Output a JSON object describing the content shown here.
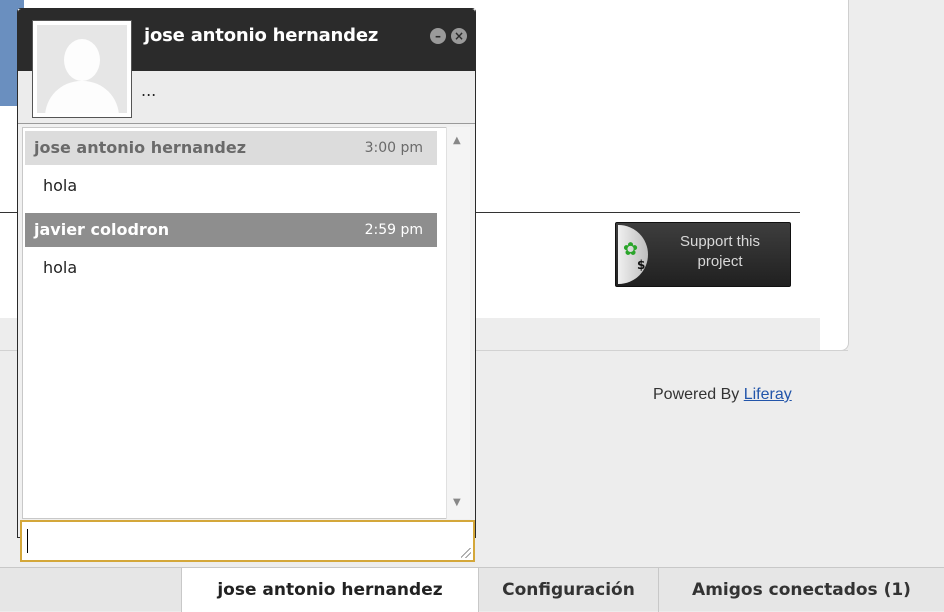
{
  "background": {
    "support_button": {
      "line1": "Support this",
      "line2": "project"
    },
    "footer": {
      "powered_prefix": "Powered By ",
      "powered_link": "Liferay"
    }
  },
  "chat_window": {
    "title": "jose antonio hernandez",
    "status": "...",
    "messages": [
      {
        "sender": "jose antonio hernandez",
        "time": "3:00 pm",
        "text": "hola"
      },
      {
        "sender": "javier colodron",
        "time": "2:59 pm",
        "text": "hola"
      }
    ],
    "input": {
      "value": "",
      "placeholder": ""
    }
  },
  "taskbar": {
    "tabs": [
      {
        "label": "jose antonio hernandez",
        "active": true
      },
      {
        "label": "Configuración",
        "active": false
      },
      {
        "label": "Amigos conectados (1)",
        "active": false
      }
    ]
  },
  "colors": {
    "chat_header": "#2b2b2b",
    "input_border": "#d4a73a",
    "link": "#2255aa"
  }
}
